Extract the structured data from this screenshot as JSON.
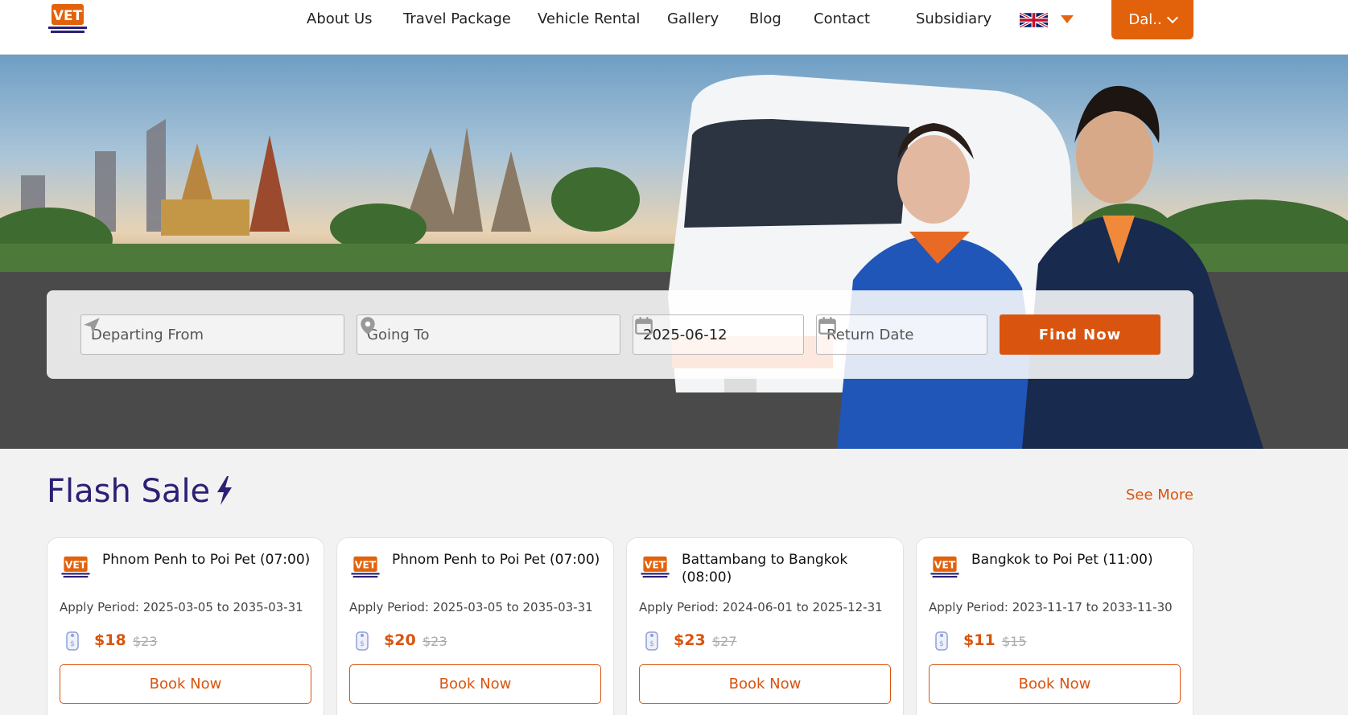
{
  "header": {
    "logo_icon": "vet-airbus-logo",
    "nav": [
      {
        "label": "About Us"
      },
      {
        "label": "Travel Package"
      },
      {
        "label": "Vehicle Rental"
      },
      {
        "label": "Gallery"
      },
      {
        "label": "Blog"
      },
      {
        "label": "Contact"
      },
      {
        "label": "Subsidiary"
      }
    ],
    "language_icon": "uk-flag-icon",
    "user_button": "Dal.."
  },
  "search": {
    "departing_placeholder": "Departing From",
    "going_placeholder": "Going To",
    "depart_date": "2025-06-12",
    "return_placeholder": "Return Date",
    "find_label": "Find Now"
  },
  "flash_sale": {
    "title": "Flash Sale",
    "see_more": "See More",
    "cards": [
      {
        "title": "Phnom Penh to Poi Pet (07:00)",
        "period": "Apply Period: 2025-03-05 to 2035-03-31",
        "price": "$18",
        "old_price": "$23",
        "book": "Book Now"
      },
      {
        "title": "Phnom Penh to Poi Pet (07:00)",
        "period": "Apply Period: 2025-03-05 to 2035-03-31",
        "price": "$20",
        "old_price": "$23",
        "book": "Book Now"
      },
      {
        "title": "Battambang to Bangkok (08:00)",
        "period": "Apply Period: 2024-06-01 to 2025-12-31",
        "price": "$23",
        "old_price": "$27",
        "book": "Book Now"
      },
      {
        "title": "Bangkok to Poi Pet (11:00)",
        "period": "Apply Period: 2023-11-17 to 2033-11-30",
        "price": "$11",
        "old_price": "$15",
        "book": "Book Now"
      }
    ]
  },
  "colors": {
    "accent": "#d9540f",
    "brand": "#2b2075"
  }
}
